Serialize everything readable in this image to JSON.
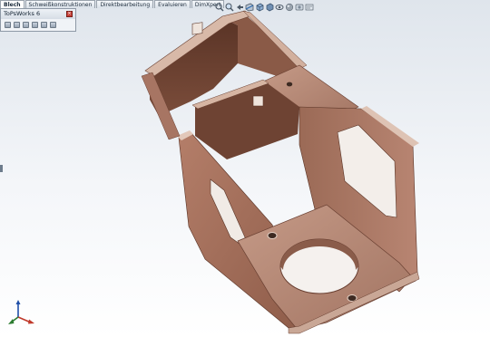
{
  "ribbon": {
    "tabs": [
      {
        "label": "Blech",
        "active": true
      },
      {
        "label": "Schweißkonstruktionen",
        "active": false
      },
      {
        "label": "Direktbearbeitung",
        "active": false
      },
      {
        "label": "Evaluieren",
        "active": false
      },
      {
        "label": "DimXpert",
        "active": false
      }
    ]
  },
  "panel": {
    "title": "ToPsWorks 6",
    "close_symbol": "×",
    "icons": [
      "sheet-icon",
      "fold-icon",
      "cut-icon",
      "export-icon",
      "settings-icon",
      "table-icon"
    ]
  },
  "view_toolbar": {
    "icons": [
      "zoom-fit-icon",
      "zoom-area-icon",
      "previous-view-icon",
      "section-view-icon",
      "view-orientation-icon",
      "display-style-icon",
      "hide-show-icon",
      "appearance-icon",
      "scene-icon",
      "display-settings-icon"
    ]
  },
  "colors": {
    "part_face": "#a4705c",
    "part_face_light": "#c0917d",
    "part_face_dark": "#6a4032",
    "part_edge": "#d9c4b8",
    "triad_x": "#c0392b",
    "triad_y": "#2e7d32",
    "triad_z": "#1f4fa8"
  }
}
